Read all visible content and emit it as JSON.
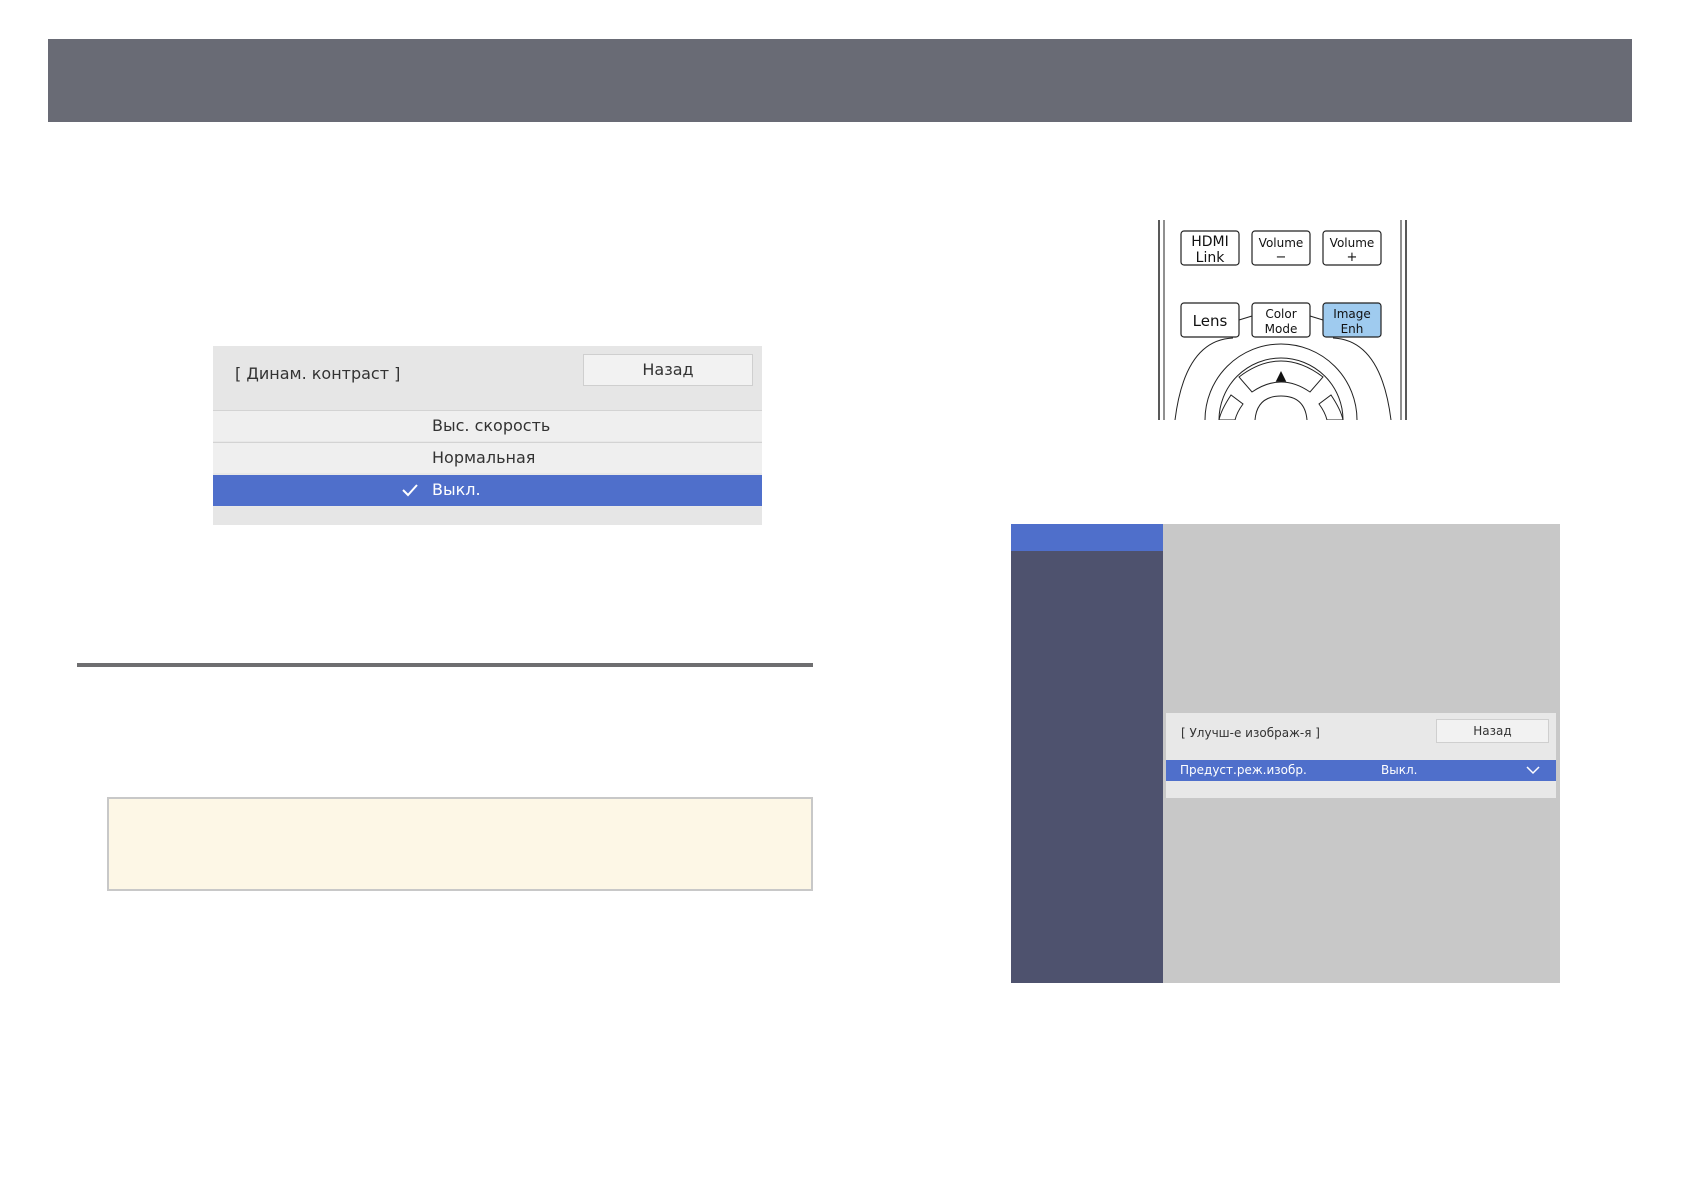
{
  "colors": {
    "header": "#696b75",
    "accent": "#4f6fcb",
    "sidebar": "#4e526e",
    "menu_bg": "#e8e8e8",
    "note_bg": "#fdf7e6",
    "highlight_button": "#9fcbef"
  },
  "dynamic_contrast_menu": {
    "title": "[ Динам. контраст ]",
    "back_label": "Назад",
    "options": [
      {
        "label": "Выс. скорость",
        "selected": false
      },
      {
        "label": "Нормальная",
        "selected": false
      },
      {
        "label": "Выкл.",
        "selected": true
      }
    ],
    "check_icon": "checkmark-icon"
  },
  "remote": {
    "row1": [
      {
        "line1": "HDMI",
        "line2": "Link"
      },
      {
        "line1": "Volume",
        "line2": "−"
      },
      {
        "line1": "Volume",
        "line2": "+"
      }
    ],
    "row2": [
      {
        "line1": "Lens",
        "line2": ""
      },
      {
        "line1": "Color",
        "line2": "Mode"
      },
      {
        "line1": "Image",
        "line2": "Enh",
        "highlighted": true
      }
    ],
    "up_arrow": "▲"
  },
  "image_enhancement_menu": {
    "title": "[ Улучш-е изображ-я ]",
    "back_label": "Назад",
    "row_label": "Предуст.реж.изобр.",
    "row_value": "Выкл.",
    "dropdown_icon": "chevron-down-icon"
  }
}
